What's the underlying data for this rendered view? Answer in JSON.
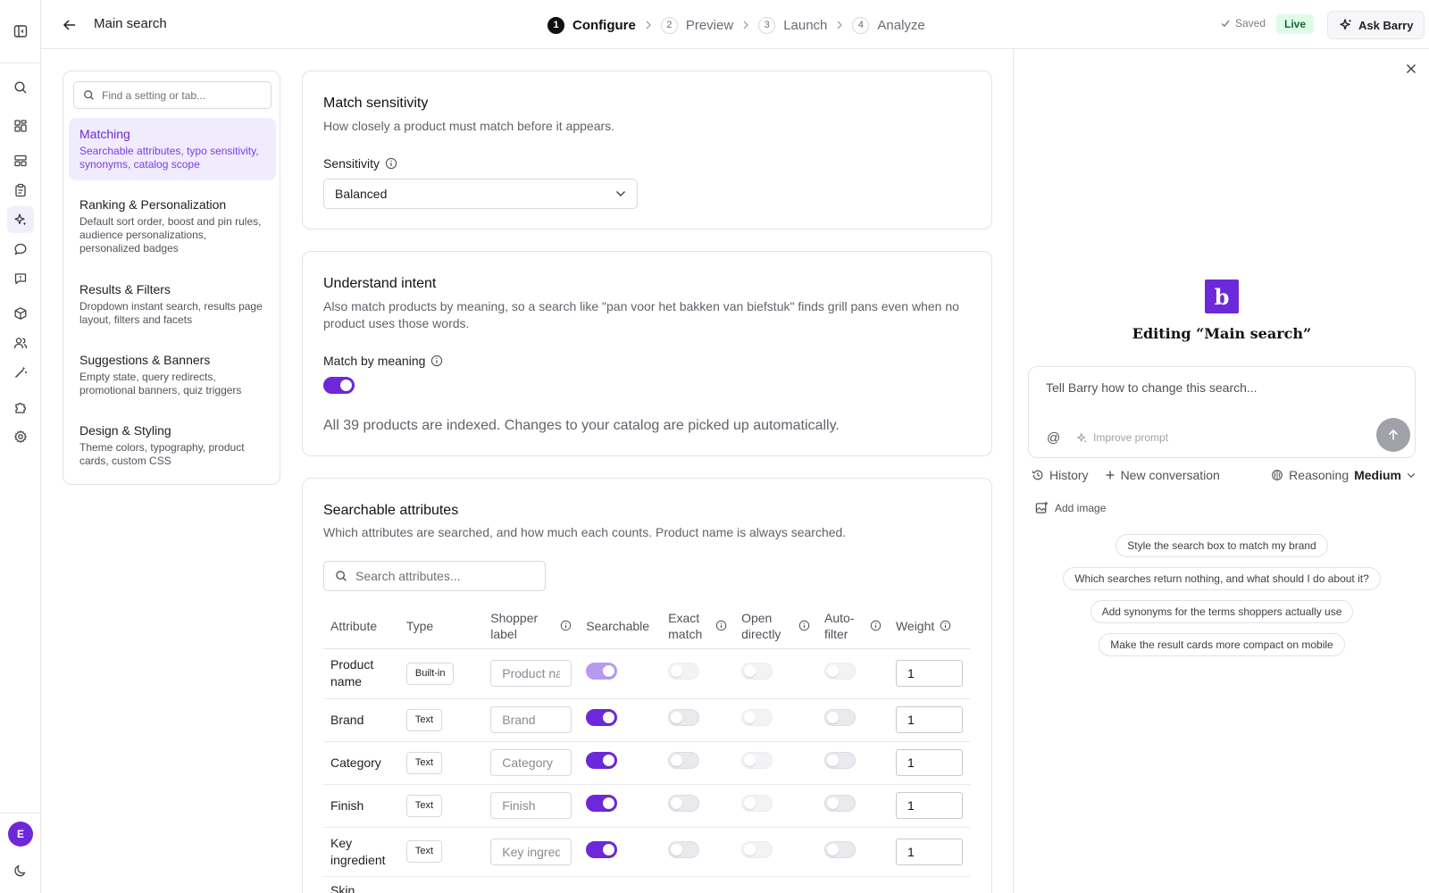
{
  "header": {
    "title": "Main search",
    "steps": [
      {
        "num": "1",
        "label": "Configure"
      },
      {
        "num": "2",
        "label": "Preview"
      },
      {
        "num": "3",
        "label": "Launch"
      },
      {
        "num": "4",
        "label": "Analyze"
      }
    ],
    "saved": "Saved",
    "live": "Live",
    "ask_barry": "Ask Barry"
  },
  "rail": {
    "avatar": "E"
  },
  "settings_nav": {
    "search_placeholder": "Find a setting or tab...",
    "items": [
      {
        "title": "Matching",
        "desc": "Searchable attributes, typo sensitivity, synonyms, catalog scope"
      },
      {
        "title": "Ranking & Personalization",
        "desc": "Default sort order, boost and pin rules, audience personalizations, personalized badges"
      },
      {
        "title": "Results & Filters",
        "desc": "Dropdown instant search, results page layout, filters and facets"
      },
      {
        "title": "Suggestions & Banners",
        "desc": "Empty state, query redirects, promotional banners, quiz triggers"
      },
      {
        "title": "Design & Styling",
        "desc": "Theme colors, typography, product cards, custom CSS"
      }
    ]
  },
  "match_sensitivity": {
    "title": "Match sensitivity",
    "subtitle": "How closely a product must match before it appears.",
    "field_label": "Sensitivity",
    "value": "Balanced"
  },
  "understand_intent": {
    "title": "Understand intent",
    "subtitle": "Also match products by meaning, so a search like \"pan voor het bakken van biefstuk\" finds grill pans even when no product uses those words.",
    "field_label": "Match by meaning",
    "indexed_note": "All 39 products are indexed. Changes to your catalog are picked up automatically."
  },
  "searchable_attributes": {
    "title": "Searchable attributes",
    "subtitle": "Which attributes are searched, and how much each counts. Product name is always searched.",
    "search_placeholder": "Search attributes...",
    "columns": {
      "attribute": "Attribute",
      "type": "Type",
      "shopper_label": "Shopper label",
      "searchable": "Searchable",
      "exact_match": "Exact match",
      "open_directly": "Open directly",
      "auto_filter": "Auto-filter",
      "weight": "Weight"
    },
    "rows": [
      {
        "attribute": "Product name",
        "type": "Built-in",
        "label_placeholder": "Product name",
        "weight": "1"
      },
      {
        "attribute": "Brand",
        "type": "Text",
        "label_placeholder": "Brand",
        "weight": "1"
      },
      {
        "attribute": "Category",
        "type": "Text",
        "label_placeholder": "Category",
        "weight": "1"
      },
      {
        "attribute": "Finish",
        "type": "Text",
        "label_placeholder": "Finish",
        "weight": "1"
      },
      {
        "attribute": "Key ingredient",
        "type": "Text",
        "label_placeholder": "Key ingredient",
        "weight": "1"
      },
      {
        "attribute": "Skin",
        "type": "",
        "label_placeholder": "",
        "weight": ""
      }
    ]
  },
  "barry": {
    "logo_letter": "b",
    "title": "Editing “Main search”",
    "prompt_placeholder": "Tell Barry how to change this search...",
    "at_symbol": "@",
    "improve_prompt": "Improve prompt",
    "history": "History",
    "new_conversation": "New conversation",
    "reasoning_label": "Reasoning",
    "reasoning_value": "Medium",
    "add_image": "Add image",
    "suggestions": [
      "Style the search box to match my brand",
      "Which searches return nothing, and what should I do about it?",
      "Add synonyms for the terms shoppers actually use",
      "Make the result cards more compact on mobile"
    ]
  },
  "colors": {
    "accent": "#6d28d9",
    "live_bg": "#dcfce7",
    "live_text": "#166534"
  }
}
